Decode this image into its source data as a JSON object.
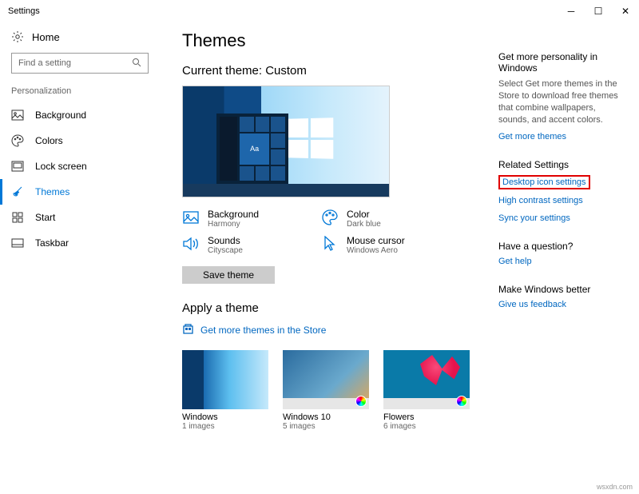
{
  "window": {
    "title": "Settings"
  },
  "sidebar": {
    "home_label": "Home",
    "search_placeholder": "Find a setting",
    "section_label": "Personalization",
    "items": [
      {
        "label": "Background",
        "icon": "picture-icon"
      },
      {
        "label": "Colors",
        "icon": "palette-icon"
      },
      {
        "label": "Lock screen",
        "icon": "frame-icon"
      },
      {
        "label": "Themes",
        "icon": "brush-icon"
      },
      {
        "label": "Start",
        "icon": "start-icon"
      },
      {
        "label": "Taskbar",
        "icon": "taskbar-icon"
      }
    ]
  },
  "main": {
    "title": "Themes",
    "current_heading": "Current theme: Custom",
    "preview_accent_label": "Aa",
    "props": {
      "background": {
        "label": "Background",
        "value": "Harmony"
      },
      "color": {
        "label": "Color",
        "value": "Dark blue"
      },
      "sounds": {
        "label": "Sounds",
        "value": "Cityscape"
      },
      "cursor": {
        "label": "Mouse cursor",
        "value": "Windows Aero"
      }
    },
    "save_label": "Save theme",
    "apply_heading": "Apply a theme",
    "store_link": "Get more themes in the Store",
    "themes": [
      {
        "name": "Windows",
        "count": "1 images"
      },
      {
        "name": "Windows 10",
        "count": "5 images"
      },
      {
        "name": "Flowers",
        "count": "6 images"
      }
    ]
  },
  "right": {
    "personality_heading": "Get more personality in Windows",
    "personality_text": "Select Get more themes in the Store to download free themes that combine wallpapers, sounds, and accent colors.",
    "get_more_link": "Get more themes",
    "related_heading": "Related Settings",
    "desktop_icon_link": "Desktop icon settings",
    "high_contrast_link": "High contrast settings",
    "sync_link": "Sync your settings",
    "question_heading": "Have a question?",
    "get_help_link": "Get help",
    "better_heading": "Make Windows better",
    "feedback_link": "Give us feedback"
  },
  "watermark": "wsxdn.com"
}
